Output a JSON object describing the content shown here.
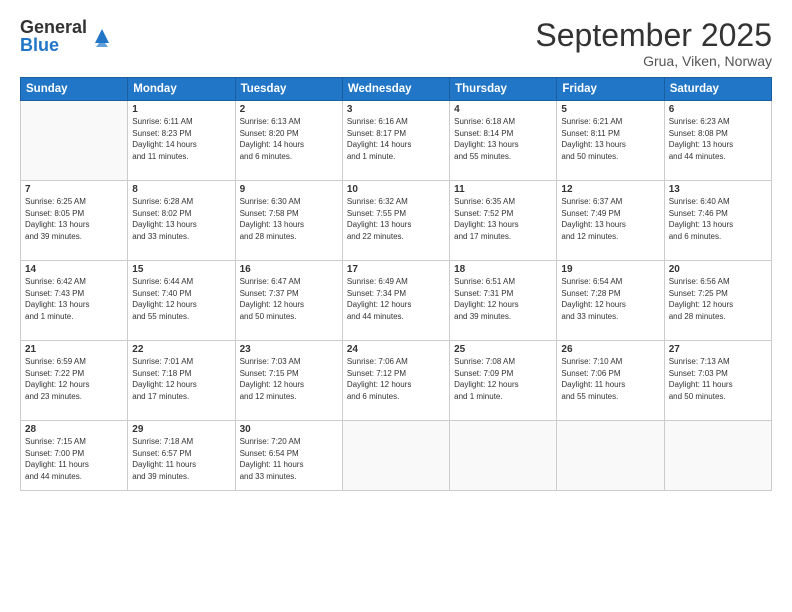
{
  "logo": {
    "general": "General",
    "blue": "Blue"
  },
  "header": {
    "month": "September 2025",
    "location": "Grua, Viken, Norway"
  },
  "weekdays": [
    "Sunday",
    "Monday",
    "Tuesday",
    "Wednesday",
    "Thursday",
    "Friday",
    "Saturday"
  ],
  "weeks": [
    [
      {
        "day": "",
        "info": ""
      },
      {
        "day": "1",
        "info": "Sunrise: 6:11 AM\nSunset: 8:23 PM\nDaylight: 14 hours\nand 11 minutes."
      },
      {
        "day": "2",
        "info": "Sunrise: 6:13 AM\nSunset: 8:20 PM\nDaylight: 14 hours\nand 6 minutes."
      },
      {
        "day": "3",
        "info": "Sunrise: 6:16 AM\nSunset: 8:17 PM\nDaylight: 14 hours\nand 1 minute."
      },
      {
        "day": "4",
        "info": "Sunrise: 6:18 AM\nSunset: 8:14 PM\nDaylight: 13 hours\nand 55 minutes."
      },
      {
        "day": "5",
        "info": "Sunrise: 6:21 AM\nSunset: 8:11 PM\nDaylight: 13 hours\nand 50 minutes."
      },
      {
        "day": "6",
        "info": "Sunrise: 6:23 AM\nSunset: 8:08 PM\nDaylight: 13 hours\nand 44 minutes."
      }
    ],
    [
      {
        "day": "7",
        "info": "Sunrise: 6:25 AM\nSunset: 8:05 PM\nDaylight: 13 hours\nand 39 minutes."
      },
      {
        "day": "8",
        "info": "Sunrise: 6:28 AM\nSunset: 8:02 PM\nDaylight: 13 hours\nand 33 minutes."
      },
      {
        "day": "9",
        "info": "Sunrise: 6:30 AM\nSunset: 7:58 PM\nDaylight: 13 hours\nand 28 minutes."
      },
      {
        "day": "10",
        "info": "Sunrise: 6:32 AM\nSunset: 7:55 PM\nDaylight: 13 hours\nand 22 minutes."
      },
      {
        "day": "11",
        "info": "Sunrise: 6:35 AM\nSunset: 7:52 PM\nDaylight: 13 hours\nand 17 minutes."
      },
      {
        "day": "12",
        "info": "Sunrise: 6:37 AM\nSunset: 7:49 PM\nDaylight: 13 hours\nand 12 minutes."
      },
      {
        "day": "13",
        "info": "Sunrise: 6:40 AM\nSunset: 7:46 PM\nDaylight: 13 hours\nand 6 minutes."
      }
    ],
    [
      {
        "day": "14",
        "info": "Sunrise: 6:42 AM\nSunset: 7:43 PM\nDaylight: 13 hours\nand 1 minute."
      },
      {
        "day": "15",
        "info": "Sunrise: 6:44 AM\nSunset: 7:40 PM\nDaylight: 12 hours\nand 55 minutes."
      },
      {
        "day": "16",
        "info": "Sunrise: 6:47 AM\nSunset: 7:37 PM\nDaylight: 12 hours\nand 50 minutes."
      },
      {
        "day": "17",
        "info": "Sunrise: 6:49 AM\nSunset: 7:34 PM\nDaylight: 12 hours\nand 44 minutes."
      },
      {
        "day": "18",
        "info": "Sunrise: 6:51 AM\nSunset: 7:31 PM\nDaylight: 12 hours\nand 39 minutes."
      },
      {
        "day": "19",
        "info": "Sunrise: 6:54 AM\nSunset: 7:28 PM\nDaylight: 12 hours\nand 33 minutes."
      },
      {
        "day": "20",
        "info": "Sunrise: 6:56 AM\nSunset: 7:25 PM\nDaylight: 12 hours\nand 28 minutes."
      }
    ],
    [
      {
        "day": "21",
        "info": "Sunrise: 6:59 AM\nSunset: 7:22 PM\nDaylight: 12 hours\nand 23 minutes."
      },
      {
        "day": "22",
        "info": "Sunrise: 7:01 AM\nSunset: 7:18 PM\nDaylight: 12 hours\nand 17 minutes."
      },
      {
        "day": "23",
        "info": "Sunrise: 7:03 AM\nSunset: 7:15 PM\nDaylight: 12 hours\nand 12 minutes."
      },
      {
        "day": "24",
        "info": "Sunrise: 7:06 AM\nSunset: 7:12 PM\nDaylight: 12 hours\nand 6 minutes."
      },
      {
        "day": "25",
        "info": "Sunrise: 7:08 AM\nSunset: 7:09 PM\nDaylight: 12 hours\nand 1 minute."
      },
      {
        "day": "26",
        "info": "Sunrise: 7:10 AM\nSunset: 7:06 PM\nDaylight: 11 hours\nand 55 minutes."
      },
      {
        "day": "27",
        "info": "Sunrise: 7:13 AM\nSunset: 7:03 PM\nDaylight: 11 hours\nand 50 minutes."
      }
    ],
    [
      {
        "day": "28",
        "info": "Sunrise: 7:15 AM\nSunset: 7:00 PM\nDaylight: 11 hours\nand 44 minutes."
      },
      {
        "day": "29",
        "info": "Sunrise: 7:18 AM\nSunset: 6:57 PM\nDaylight: 11 hours\nand 39 minutes."
      },
      {
        "day": "30",
        "info": "Sunrise: 7:20 AM\nSunset: 6:54 PM\nDaylight: 11 hours\nand 33 minutes."
      },
      {
        "day": "",
        "info": ""
      },
      {
        "day": "",
        "info": ""
      },
      {
        "day": "",
        "info": ""
      },
      {
        "day": "",
        "info": ""
      }
    ]
  ]
}
